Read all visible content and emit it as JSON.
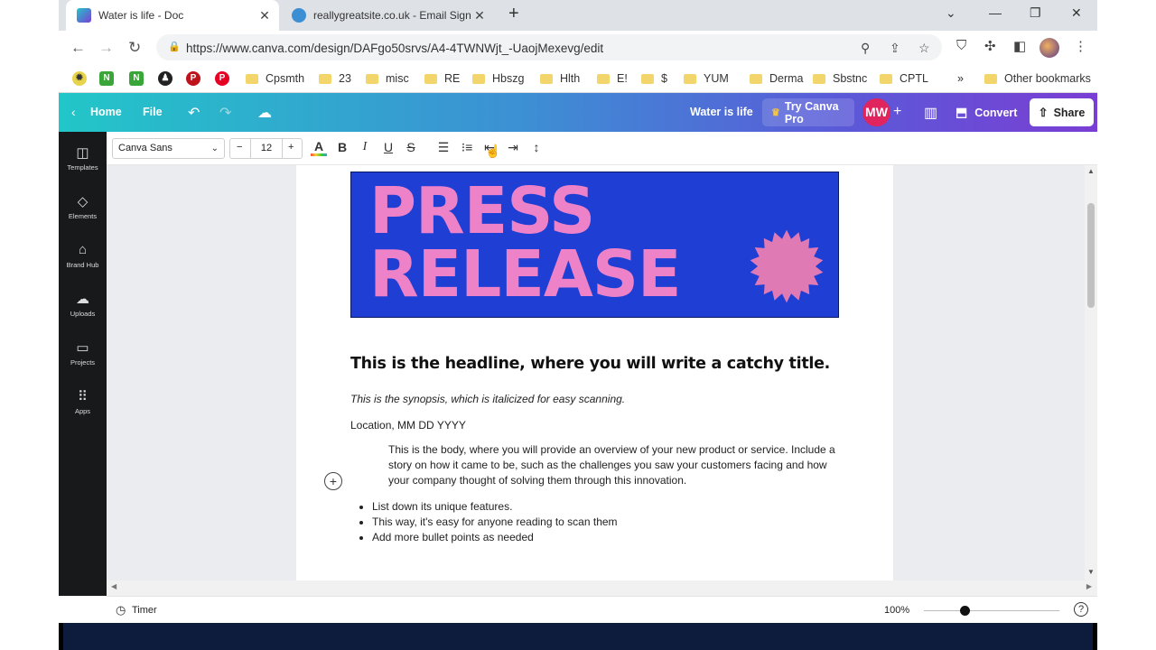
{
  "browser": {
    "tabs": [
      {
        "title": "Water is life - Doc",
        "active": true
      },
      {
        "title": "reallygreatsite.co.uk - Email Signa",
        "active": false
      }
    ],
    "url": "https://www.canva.com/design/DAFgo50srvs/A4-4TWNWjt_-UaojMexevg/edit"
  },
  "bookmarks": {
    "items": [
      "Cpsmth",
      "23",
      "misc",
      "RE",
      "Hbszg",
      "Hlth",
      "E!",
      "$",
      "YUM",
      "Derma",
      "Sbstnc",
      "CPTL"
    ],
    "overflow": "»",
    "other": "Other bookmarks"
  },
  "canva_bar": {
    "home": "Home",
    "file": "File",
    "doc_title": "Water is life",
    "try_pro": "Try Canva Pro",
    "user_initials": "MW",
    "convert": "Convert",
    "share": "Share"
  },
  "sidebar": {
    "items": [
      "Templates",
      "Elements",
      "Brand Hub",
      "Uploads",
      "Projects",
      "Apps"
    ]
  },
  "format_bar": {
    "font": "Canva Sans",
    "size": "12",
    "minus": "−",
    "plus": "+"
  },
  "document": {
    "banner_line1": "PRESS",
    "banner_line2": "RELEASE",
    "headline": "This is the headline, where you will write a catchy title.",
    "synopsis": "This is the synopsis, which is italicized for easy scanning.",
    "location": "Location, MM DD YYYY",
    "body": "This is the body, where you will provide an overview of your new product or service. Include a story on how it came to be, such as the challenges you saw your customers facing and how your company thought of solving them through this innovation.",
    "bullets": [
      "List down its unique features.",
      "This way, it's easy for anyone reading to scan them",
      "Add more bullet points as needed"
    ]
  },
  "footer": {
    "timer": "Timer",
    "zoom": "100%",
    "zoom_level": 0.3,
    "help": "?"
  },
  "colors": {
    "banner_bg": "#1f3fd4",
    "banner_text": "#ee82c8",
    "accent_pro": "#e0245e"
  }
}
